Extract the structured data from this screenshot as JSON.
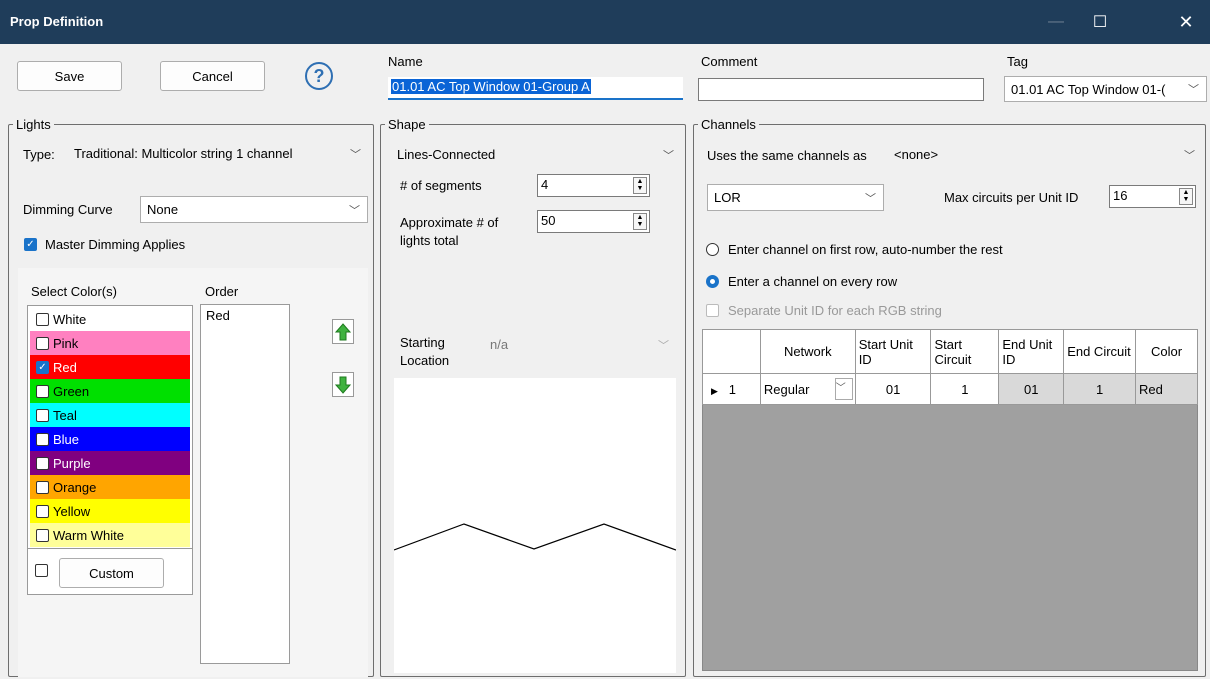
{
  "window": {
    "title": "Prop Definition"
  },
  "toolbar": {
    "save_label": "Save",
    "cancel_label": "Cancel",
    "help_label": "?"
  },
  "name": {
    "label": "Name",
    "value": "01.01 AC Top Window 01-Group A"
  },
  "comment": {
    "label": "Comment",
    "value": ""
  },
  "tag": {
    "label": "Tag",
    "value": "01.01 AC Top Window 01-("
  },
  "lights": {
    "group_label": "Lights",
    "type_label": "Type:",
    "type_value": "Traditional: Multicolor string 1 channel",
    "dimming_label": "Dimming Curve",
    "dimming_value": "None",
    "master_label": "Master Dimming Applies",
    "select_label": "Select Color(s)",
    "order_label": "Order",
    "order_items": [
      "Red"
    ],
    "custom_label": "Custom",
    "colors": [
      {
        "label": "White",
        "color": "#ffffff",
        "text": "#000000",
        "checked": false
      },
      {
        "label": "Pink",
        "color": "#ff80c0",
        "text": "#000000",
        "checked": false
      },
      {
        "label": "Red",
        "color": "#ff0000",
        "text": "#ffffff",
        "checked": true
      },
      {
        "label": "Green",
        "color": "#00e000",
        "text": "#000000",
        "checked": false
      },
      {
        "label": "Teal",
        "color": "#00ffff",
        "text": "#000000",
        "checked": false
      },
      {
        "label": "Blue",
        "color": "#0000ff",
        "text": "#ffffff",
        "checked": false
      },
      {
        "label": "Purple",
        "color": "#800080",
        "text": "#ffffff",
        "checked": false
      },
      {
        "label": "Orange",
        "color": "#ffa500",
        "text": "#000000",
        "checked": false
      },
      {
        "label": "Yellow",
        "color": "#ffff00",
        "text": "#000000",
        "checked": false
      },
      {
        "label": "Warm White",
        "color": "#ffff99",
        "text": "#000000",
        "checked": false
      }
    ]
  },
  "shape": {
    "group_label": "Shape",
    "type_value": "Lines-Connected",
    "segments_label": "# of segments",
    "segments_value": "4",
    "approx_label_1": "Approximate # of",
    "approx_label_2": "lights total",
    "approx_value": "50",
    "start_label_1": "Starting",
    "start_label_2": "Location",
    "start_value": "n/a"
  },
  "channels": {
    "group_label": "Channels",
    "same_label": "Uses the same channels as",
    "same_value": "<none>",
    "network_type": "LOR",
    "max_label": "Max circuits per Unit ID",
    "max_value": "16",
    "radio1": "Enter channel on first row, auto-number the rest",
    "radio2": "Enter a channel on every row",
    "separate_label": "Separate Unit ID for each RGB string",
    "headers": [
      "",
      "Network",
      "Start Unit ID",
      "Start Circuit",
      "End Unit ID",
      "End Circuit",
      "Color"
    ],
    "rows": [
      {
        "num": "1",
        "network": "Regular",
        "start_unit": "01",
        "start_circuit": "1",
        "end_unit": "01",
        "end_circuit": "1",
        "color": "Red"
      }
    ]
  },
  "accent_color": "#1a73c9",
  "titlebar_color": "#1f3d5a"
}
